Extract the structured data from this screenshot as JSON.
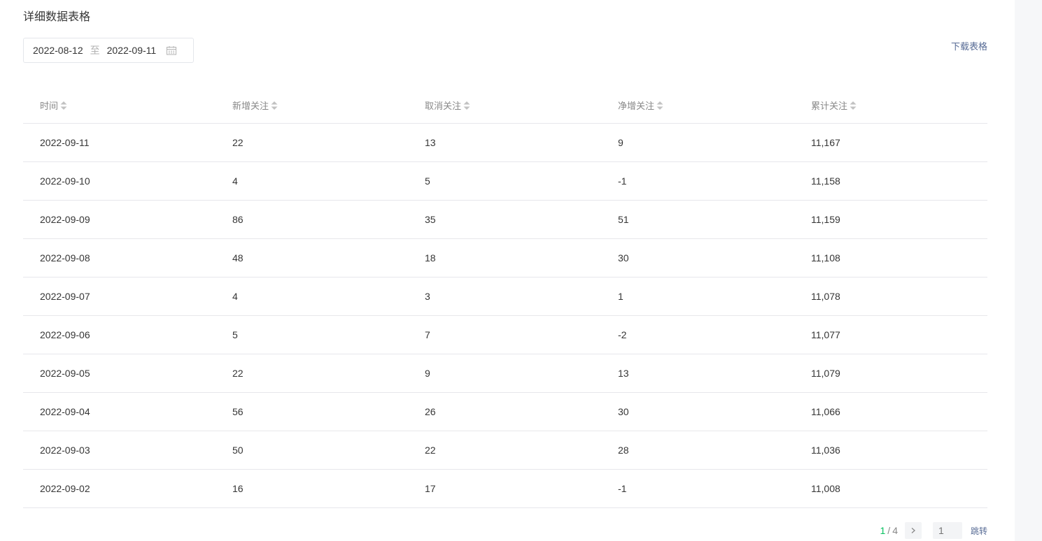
{
  "section": {
    "title": "详细数据表格"
  },
  "date_range": {
    "start": "2022-08-12",
    "separator": "至",
    "end": "2022-09-11"
  },
  "download": {
    "label": "下载表格"
  },
  "table": {
    "columns": [
      "时间",
      "新增关注",
      "取消关注",
      "净增关注",
      "累计关注"
    ],
    "rows": [
      [
        "2022-09-11",
        "22",
        "13",
        "9",
        "11,167"
      ],
      [
        "2022-09-10",
        "4",
        "5",
        "-1",
        "11,158"
      ],
      [
        "2022-09-09",
        "86",
        "35",
        "51",
        "11,159"
      ],
      [
        "2022-09-08",
        "48",
        "18",
        "30",
        "11,108"
      ],
      [
        "2022-09-07",
        "4",
        "3",
        "1",
        "11,078"
      ],
      [
        "2022-09-06",
        "5",
        "7",
        "-2",
        "11,077"
      ],
      [
        "2022-09-05",
        "22",
        "9",
        "13",
        "11,079"
      ],
      [
        "2022-09-04",
        "56",
        "26",
        "30",
        "11,066"
      ],
      [
        "2022-09-03",
        "50",
        "22",
        "28",
        "11,036"
      ],
      [
        "2022-09-02",
        "16",
        "17",
        "-1",
        "11,008"
      ]
    ]
  },
  "pagination": {
    "current": "1",
    "separator": "/",
    "total": "4",
    "input_placeholder": "1",
    "jump_label": "跳转"
  },
  "colors": {
    "accent_green": "#07c160",
    "link_blue": "#576b95",
    "border": "#e7e7eb"
  },
  "icons": [
    "calendar-icon",
    "sort-icon",
    "chevron-right-icon"
  ]
}
